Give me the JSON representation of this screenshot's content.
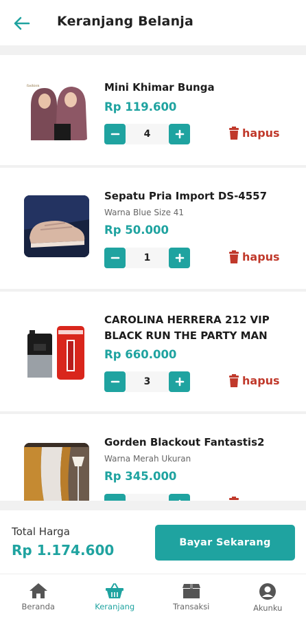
{
  "header": {
    "title": "Keranjang Belanja"
  },
  "items": [
    {
      "name": "Mini Khimar Bunga",
      "variant": "",
      "price": "Rp 119.600",
      "qty": "4",
      "delete_label": "hapus"
    },
    {
      "name": "Sepatu Pria Import DS-4557",
      "variant": "Warna Blue Size 41",
      "price": "Rp 50.000",
      "qty": "1",
      "delete_label": "hapus"
    },
    {
      "name": "CAROLINA HERRERA 212 VIP BLACK RUN THE PARTY MAN",
      "variant": "",
      "price": "Rp 660.000",
      "qty": "3",
      "delete_label": "hapus"
    },
    {
      "name": "Gorden Blackout Fantastis2",
      "variant": "Warna Merah Ukuran",
      "price": "Rp 345.000",
      "qty": "",
      "delete_label": ""
    }
  ],
  "summary": {
    "total_label": "Total Harga",
    "total_value": "Rp 1.174.600",
    "pay_label": "Bayar Sekarang"
  },
  "nav": [
    {
      "label": "Beranda",
      "icon": "home-icon"
    },
    {
      "label": "Keranjang",
      "icon": "basket-icon",
      "active": true
    },
    {
      "label": "Transaksi",
      "icon": "box-icon"
    },
    {
      "label": "Akunku",
      "icon": "account-icon"
    }
  ],
  "colors": {
    "accent": "#1fa3a0",
    "delete": "#c0392b"
  }
}
